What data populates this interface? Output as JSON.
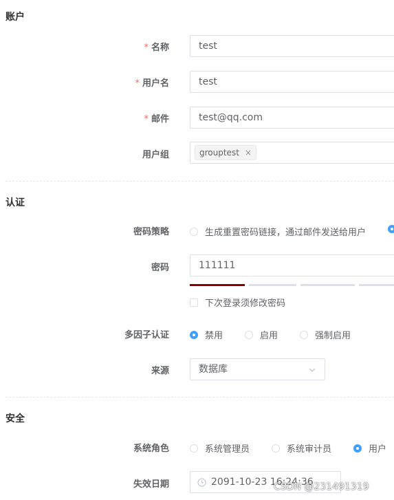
{
  "sections": {
    "account": "账户",
    "auth": "认证",
    "security": "安全"
  },
  "fields": {
    "name": {
      "label": "名称",
      "required_mark": "*",
      "value": "test"
    },
    "username": {
      "label": "用户名",
      "required_mark": "*",
      "value": "test"
    },
    "email": {
      "label": "邮件",
      "required_mark": "*",
      "value": "test@qq.com"
    },
    "group": {
      "label": "用户组",
      "tag": "grouptest",
      "remove_glyph": "×"
    },
    "password_policy": {
      "label": "密码策略",
      "options": [
        "生成重置密码链接，通过邮件发送给用户"
      ]
    },
    "password": {
      "label": "密码",
      "value": "111111",
      "strength_levels": 4,
      "strength_filled": 1
    },
    "must_change": {
      "label": "下次登录须修改密码"
    },
    "mfa": {
      "label": "多因子认证",
      "options": [
        "禁用",
        "启用",
        "强制启用"
      ],
      "selected": "禁用"
    },
    "source": {
      "label": "来源",
      "value": "数据库"
    },
    "system_role": {
      "label": "系统角色",
      "options": [
        "系统管理员",
        "系统审计员",
        "用户"
      ],
      "selected": "用户"
    },
    "expire_date": {
      "label": "失效日期",
      "value": "2091-10-23 16:24:36"
    }
  },
  "colors": {
    "accent": "#409eff",
    "required": "#f56c6c",
    "strength_weak": "#8b0000",
    "strength_empty": "#dcdfe6"
  },
  "watermark": "CSDN @231491319"
}
